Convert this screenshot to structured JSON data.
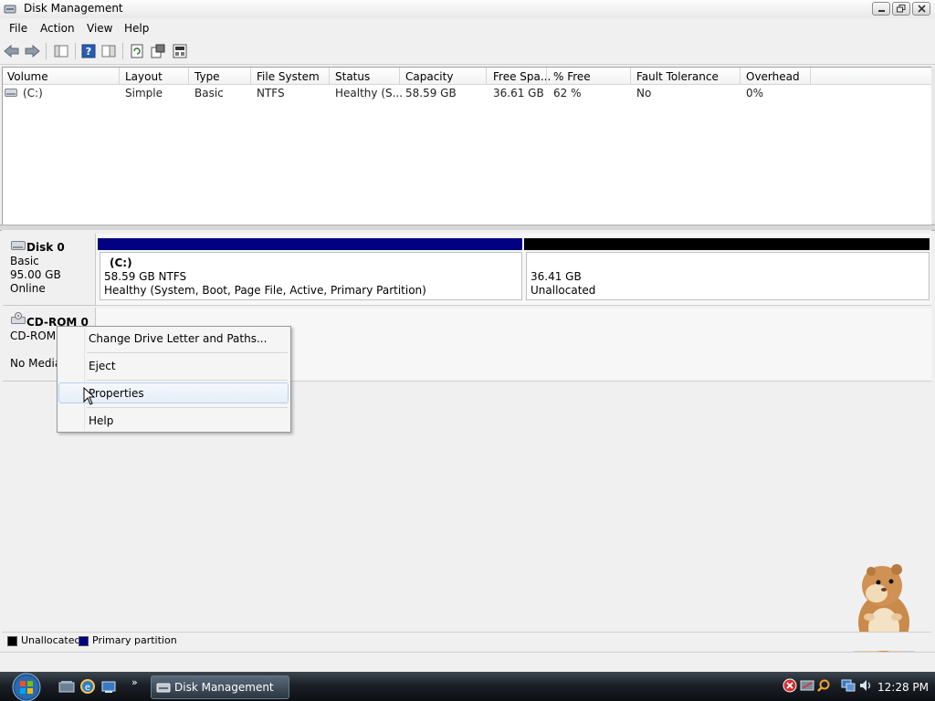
{
  "window": {
    "title": "Disk Management"
  },
  "menu": [
    "File",
    "Action",
    "View",
    "Help"
  ],
  "toolbar": {
    "icons": [
      "back-icon",
      "forward-icon",
      "console-tree-icon",
      "help-icon",
      "show-hide-icon",
      "refresh-icon",
      "properties-icon",
      "settings-icon"
    ]
  },
  "volume_table": {
    "columns": [
      "Volume",
      "Layout",
      "Type",
      "File System",
      "Status",
      "Capacity",
      "Free Spa...",
      "% Free",
      "Fault Tolerance",
      "Overhead"
    ],
    "rows": [
      {
        "volume": "(C:)",
        "layout": "Simple",
        "type": "Basic",
        "file_system": "NTFS",
        "status": "Healthy (S...",
        "capacity": "58.59 GB",
        "free_space": "36.61 GB",
        "pct_free": "62 %",
        "fault_tolerance": "No",
        "overhead": "0%"
      }
    ]
  },
  "disks": [
    {
      "name": "Disk 0",
      "type": "Basic",
      "size": "95.00 GB",
      "state": "Online",
      "partitions": [
        {
          "label": "(C:)",
          "detail": "58.59 GB NTFS",
          "status": "Healthy (System, Boot, Page File, Active, Primary Partition)",
          "color": "#000080"
        },
        {
          "detail": "36.41 GB",
          "status": "Unallocated",
          "color": "#000000"
        }
      ]
    },
    {
      "name": "CD-ROM 0",
      "type": "CD-ROM",
      "media": "No Media"
    }
  ],
  "context_menu": {
    "items": [
      "Change Drive Letter and Paths...",
      "Eject",
      "Properties",
      "Help"
    ],
    "highlighted": "Properties"
  },
  "legend": [
    {
      "label": "Unallocated",
      "color": "#000000"
    },
    {
      "label": "Primary partition",
      "color": "#000080"
    }
  ],
  "taskbar": {
    "task_button": "Disk Management",
    "clock": "12:28 PM"
  }
}
